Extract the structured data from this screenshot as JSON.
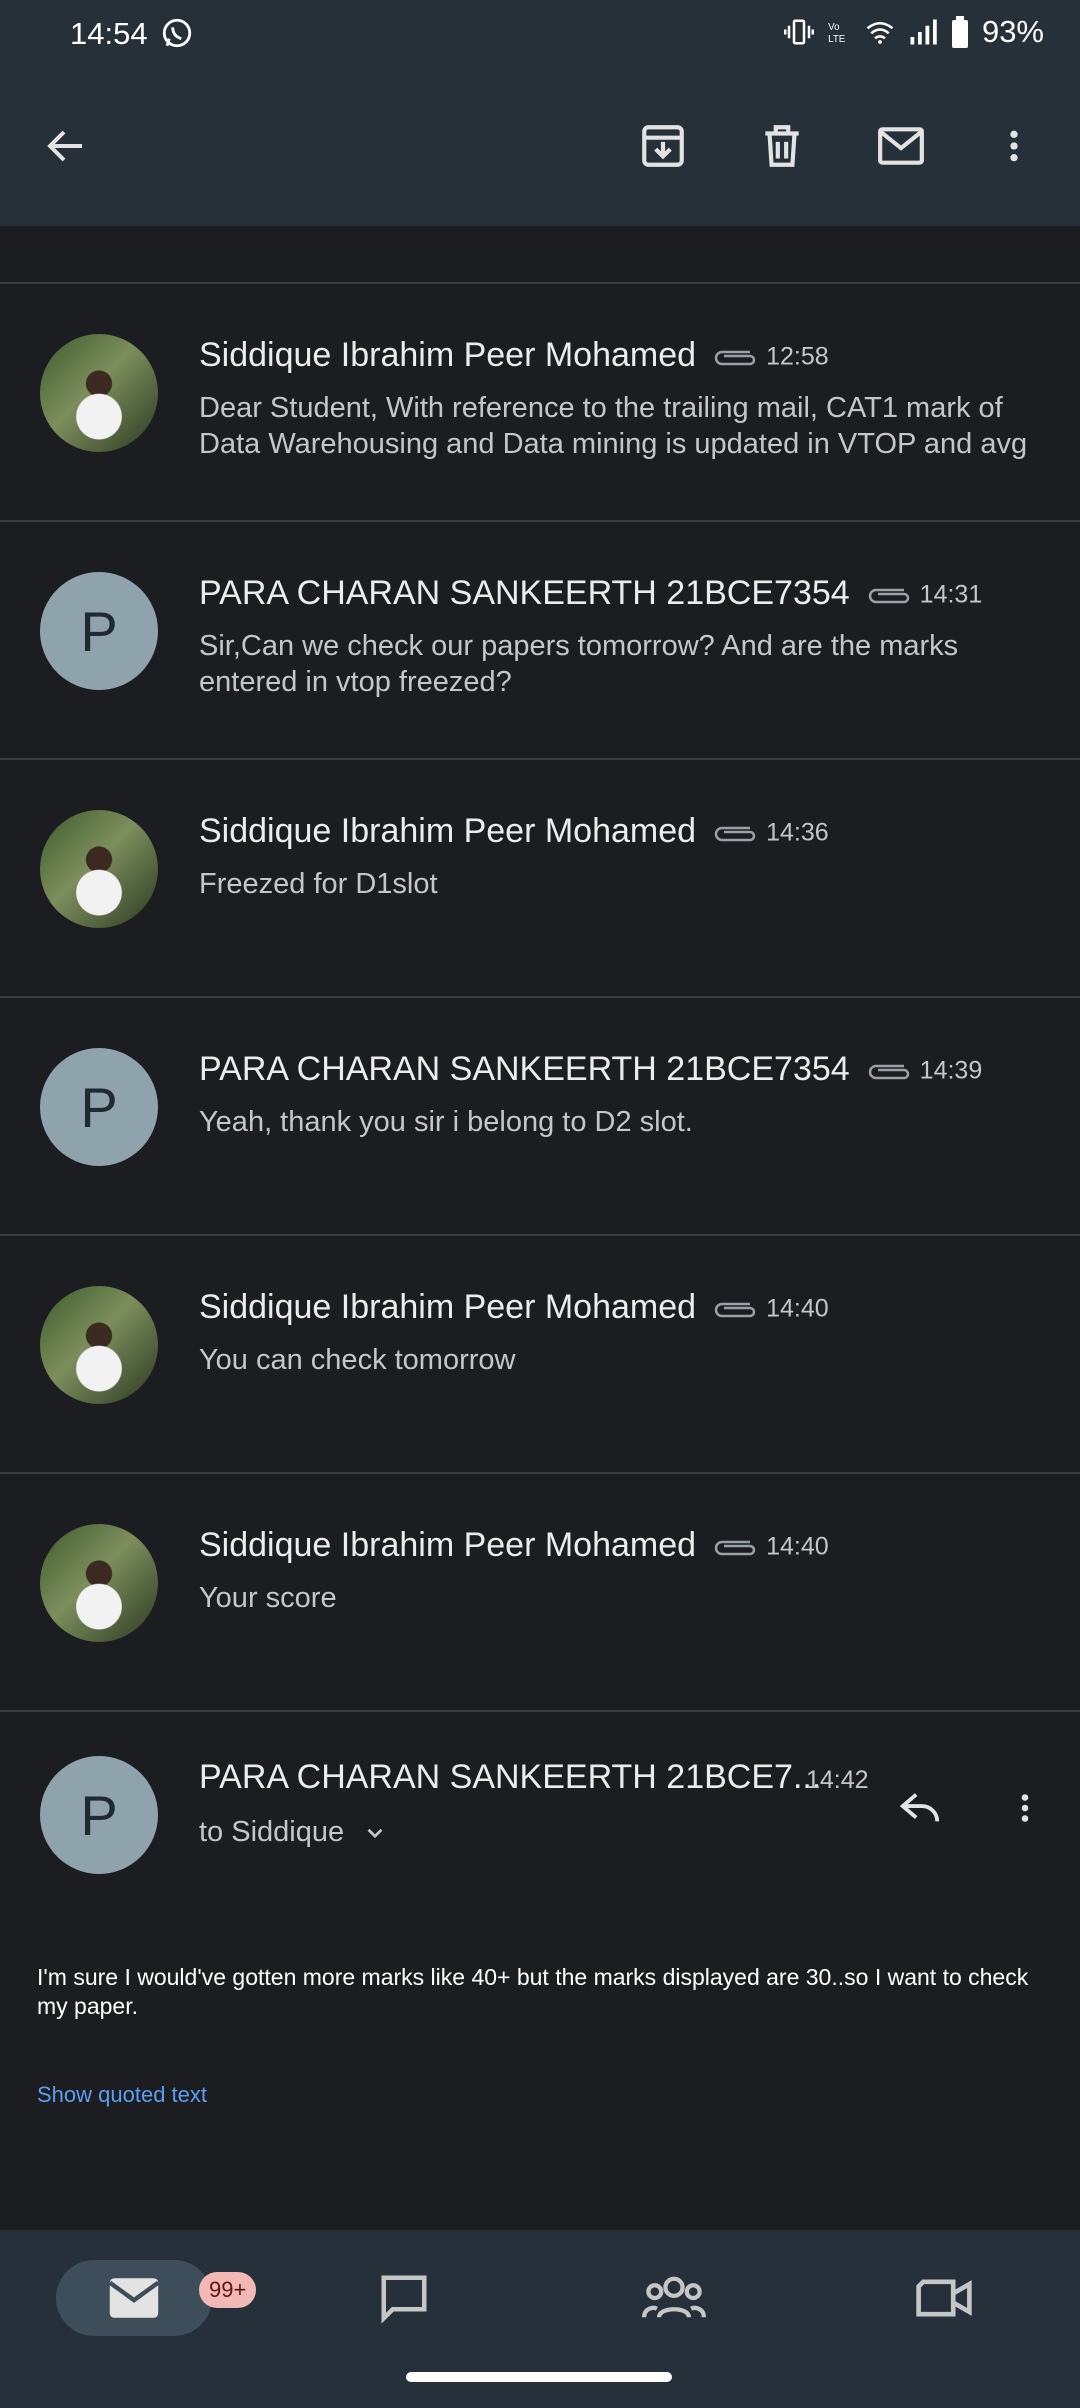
{
  "status_bar": {
    "time": "14:54",
    "battery": "93%"
  },
  "thread": {
    "messages": [
      {
        "sender": "Siddique Ibrahim Peer Mohamed",
        "time": "12:58",
        "snippet": "Dear Student, With reference to the trailing mail, CAT1 mark of Data Warehousing and Data mining is updated in VTOP and avg",
        "avatar": "photo"
      },
      {
        "sender": "PARA CHARAN SANKEERTH 21BCE7354",
        "time": "14:31",
        "snippet": "Sir,Can we check our papers tomorrow? And are the marks entered in vtop freezed?",
        "avatar": "P"
      },
      {
        "sender": "Siddique Ibrahim Peer Mohamed",
        "time": "14:36",
        "snippet": "Freezed for D1slot",
        "avatar": "photo"
      },
      {
        "sender": "PARA CHARAN SANKEERTH 21BCE7354",
        "time": "14:39",
        "snippet": "Yeah, thank you sir i belong to D2 slot.",
        "avatar": "P"
      },
      {
        "sender": "Siddique Ibrahim Peer Mohamed",
        "time": "14:40",
        "snippet": "You can check tomorrow",
        "avatar": "photo"
      },
      {
        "sender": "Siddique Ibrahim Peer Mohamed",
        "time": "14:40",
        "snippet": "Your score",
        "avatar": "photo"
      }
    ],
    "open_message": {
      "avatar": "P",
      "sender": "PARA CHARAN SANKEERTH 21BCE7...",
      "time": "14:42",
      "to": "to Siddique",
      "body": "I'm sure I would've gotten more marks like 40+ but the marks displayed are 30..so I want to check my paper.",
      "show_quoted": "Show quoted text"
    }
  },
  "bottom_nav": {
    "mail_badge": "99+"
  },
  "colors": {
    "background": "#1b1d20",
    "appbar": "#263038",
    "link": "#5c9ef0",
    "badge": "#f2b8b5"
  }
}
